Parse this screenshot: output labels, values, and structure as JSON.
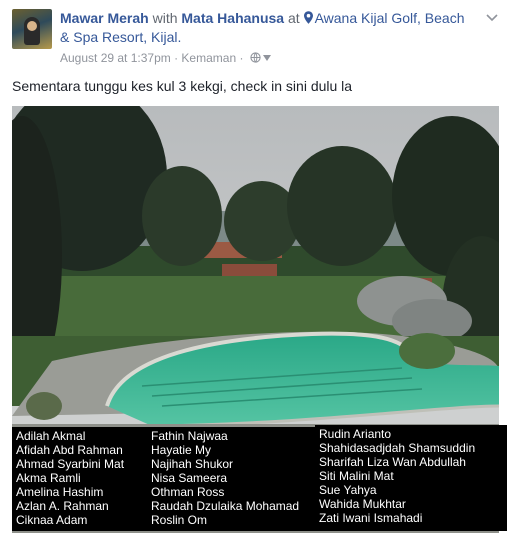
{
  "post": {
    "author": "Mawar Merah",
    "with_word": " with ",
    "with_name": "Mata Hahanusa",
    "at_word": " at ",
    "location": "Awana Kijal Golf, Beach & Spa Resort, Kijal.",
    "timestamp": "August 29 at 1:37pm",
    "separator": " · ",
    "app": "Kemaman",
    "separator2": " · ",
    "caption": "Sementara tunggu kes kul 3 kekgi, check in sini dulu la"
  },
  "tags": {
    "column1": [
      "Adilah Akmal",
      "Afidah Abd Rahman",
      "Ahmad Syarbini Mat",
      "Akma Ramli",
      "Amelina Hashim",
      "Azlan A. Rahman",
      "Ciknaa Adam"
    ],
    "column2": [
      "Fathin Najwaa",
      "Hayatie My",
      "Najihah Shukor",
      "Nisa Sameera",
      "Othman Ross",
      "Raudah Dzulaika Mohamad",
      "Roslin Om"
    ],
    "column3": [
      "Rudin Arianto",
      "Shahidasadjdah Shamsuddin",
      "Sharifah Liza Wan Abdullah",
      "Siti Malini Mat",
      "Sue Yahya",
      "Wahida Mukhtar",
      "Zati Iwani Ismahadi"
    ]
  },
  "icons": {
    "location": "map-pin-icon",
    "privacy": "globe-icon",
    "menu": "chevron-down-icon"
  },
  "colors": {
    "link": "#365899",
    "muted": "#90949c",
    "text": "#1d2129",
    "pool": "#3fb79a"
  }
}
